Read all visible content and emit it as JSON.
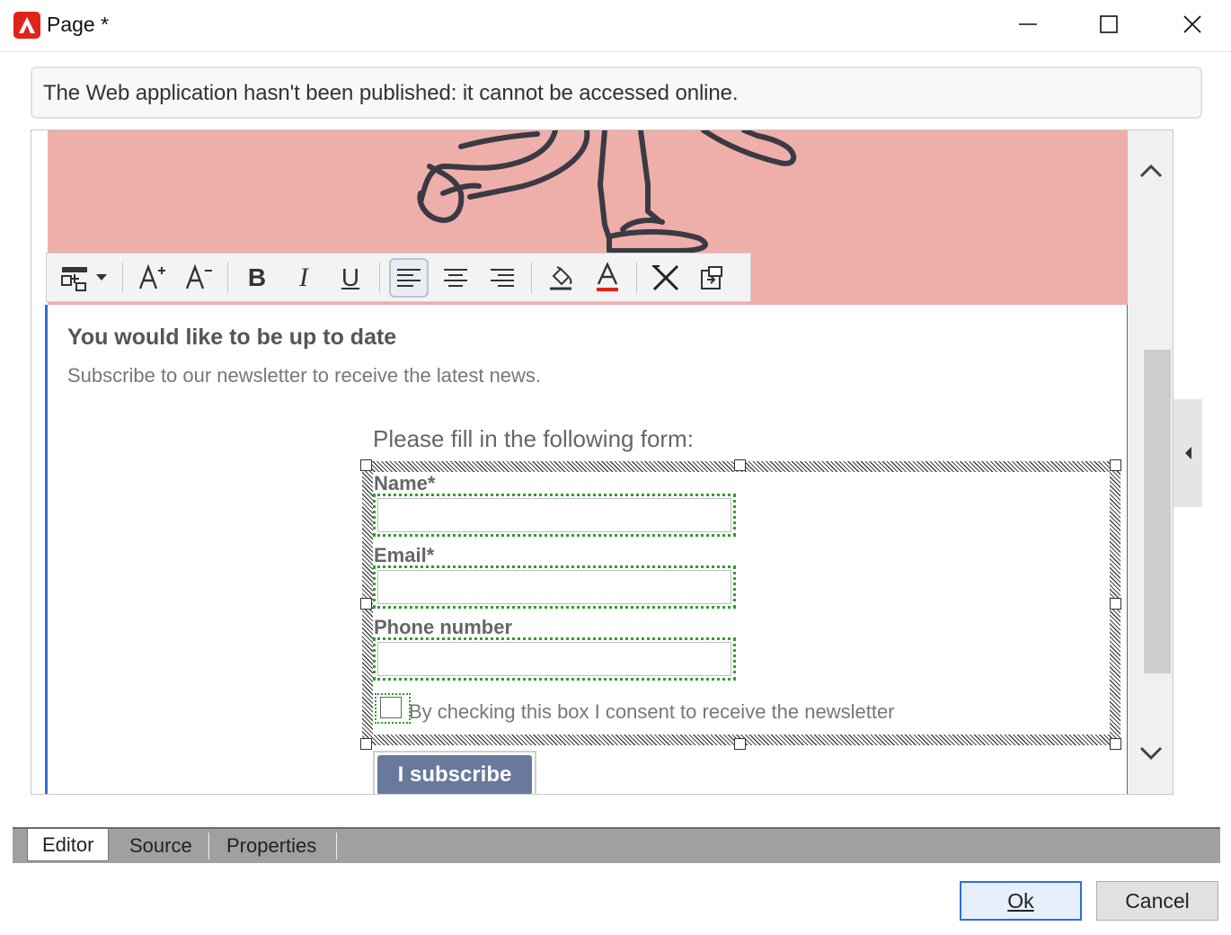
{
  "window": {
    "title": "Page *",
    "minimize_icon": "minimize-icon",
    "maximize_icon": "maximize-icon",
    "close_icon": "close-icon"
  },
  "banner": {
    "message": "The Web application hasn't been published: it cannot be accessed online."
  },
  "toolbar": {
    "buttons": [
      {
        "name": "insert-field-icon"
      },
      {
        "name": "increase-font-icon",
        "label": "A+"
      },
      {
        "name": "decrease-font-icon",
        "label": "A-"
      },
      {
        "name": "bold-icon",
        "label": "B"
      },
      {
        "name": "italic-icon",
        "label": "I"
      },
      {
        "name": "underline-icon",
        "label": "U"
      },
      {
        "name": "align-left-icon",
        "active": true
      },
      {
        "name": "align-center-icon"
      },
      {
        "name": "align-right-icon"
      },
      {
        "name": "fill-color-icon"
      },
      {
        "name": "font-color-icon",
        "label": "A"
      },
      {
        "name": "remove-format-icon"
      },
      {
        "name": "insert-object-icon"
      }
    ],
    "font_color_accent": "#e2231a"
  },
  "content": {
    "heading": "You would like to be up to date",
    "subheading": "Subscribe to our newsletter to receive the latest news.",
    "form_intro": "Please fill in the following form:",
    "fields": [
      {
        "label": "Name*",
        "value": ""
      },
      {
        "label": "Email*",
        "value": ""
      },
      {
        "label": "Phone number",
        "value": ""
      }
    ],
    "consent_label": "By checking this box I consent to receive the newsletter",
    "subscribe_label": "I subscribe",
    "hero_color": "#eeaeaa",
    "button_color": "#68799c"
  },
  "tabs": [
    {
      "label": "Editor",
      "active": true
    },
    {
      "label": "Source",
      "active": false
    },
    {
      "label": "Properties",
      "active": false
    }
  ],
  "dialog": {
    "ok_label": "Ok",
    "cancel_label": "Cancel"
  }
}
